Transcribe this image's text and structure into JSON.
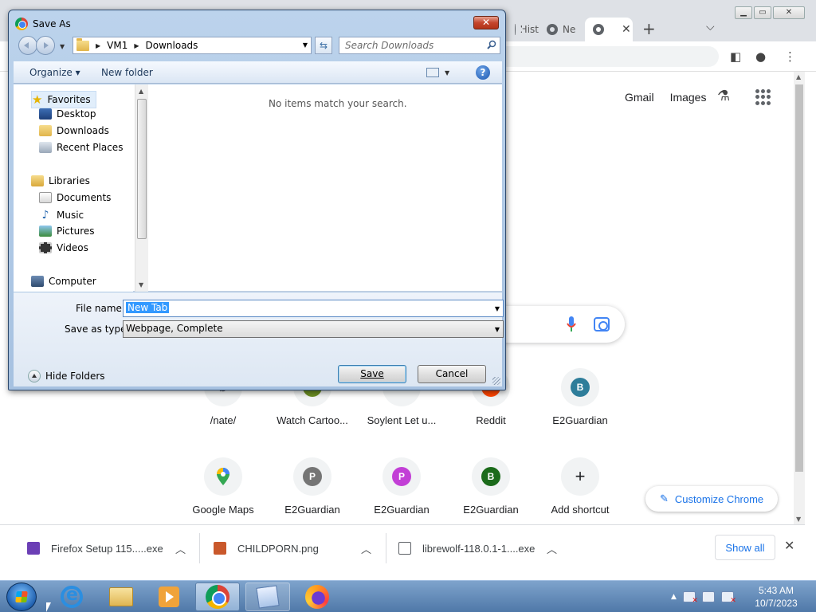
{
  "browser": {
    "tabs": [
      {
        "label": "Hist"
      },
      {
        "label": "Ne"
      },
      {
        "label": ""
      }
    ],
    "new_tab_symbol": "+",
    "tab_search_symbol": "⌵",
    "top_links": {
      "gmail": "Gmail",
      "images": "Images"
    },
    "shortcuts_row1": [
      {
        "label": "/nate/"
      },
      {
        "label": "Watch Cartoo..."
      },
      {
        "label": "Soylent Let u..."
      },
      {
        "label": "Reddit"
      },
      {
        "label": "E2Guardian",
        "letter": "B",
        "color": "#2e7d9a"
      }
    ],
    "shortcuts_row2": [
      {
        "label": "Google Maps"
      },
      {
        "label": "E2Guardian",
        "letter": "P",
        "color": "#757575"
      },
      {
        "label": "E2Guardian",
        "letter": "P",
        "color": "#c23fd6"
      },
      {
        "label": "E2Guardian",
        "letter": "B",
        "color": "#1b6b1b"
      },
      {
        "label": "Add shortcut",
        "symbol": "+"
      }
    ],
    "customize_label": "Customize Chrome"
  },
  "downloads": {
    "items": [
      {
        "name": "Firefox Setup 115.....exe",
        "icon_color": "#6b3fb5"
      },
      {
        "name": "CHILDPORN.png",
        "icon_color": "#c9582b"
      },
      {
        "name": "librewolf-118.0.1-1....exe",
        "icon_color": "#5f6368"
      }
    ],
    "show_all": "Show all",
    "close_symbol": "✕"
  },
  "dialog": {
    "title": "Save As",
    "close_symbol": "✕",
    "breadcrumb": [
      "VM1",
      "Downloads"
    ],
    "search_placeholder": "Search Downloads",
    "toolbar": {
      "organize": "Organize ▾",
      "new_folder": "New folder",
      "help": "?"
    },
    "nav": {
      "favorites": "Favorites",
      "favorites_items": [
        "Desktop",
        "Downloads",
        "Recent Places"
      ],
      "libraries": "Libraries",
      "libraries_items": [
        "Documents",
        "Music",
        "Pictures",
        "Videos"
      ],
      "computer": "Computer"
    },
    "empty_message": "No items match your search.",
    "file_name_label": "File name:",
    "file_name_value": "New Tab",
    "save_type_label": "Save as type:",
    "save_type_value": "Webpage, Complete",
    "hide_folders": "Hide Folders",
    "save_button": "Save",
    "cancel_button": "Cancel"
  },
  "taskbar": {
    "clock_time": "5:43 AM",
    "clock_date": "10/7/2023",
    "tray_arrow": "▲"
  },
  "colors": {
    "dialog_frame": "#a6c1e0",
    "taskbar": "#4f78a8",
    "chrome_accent": "#1a73e8"
  }
}
